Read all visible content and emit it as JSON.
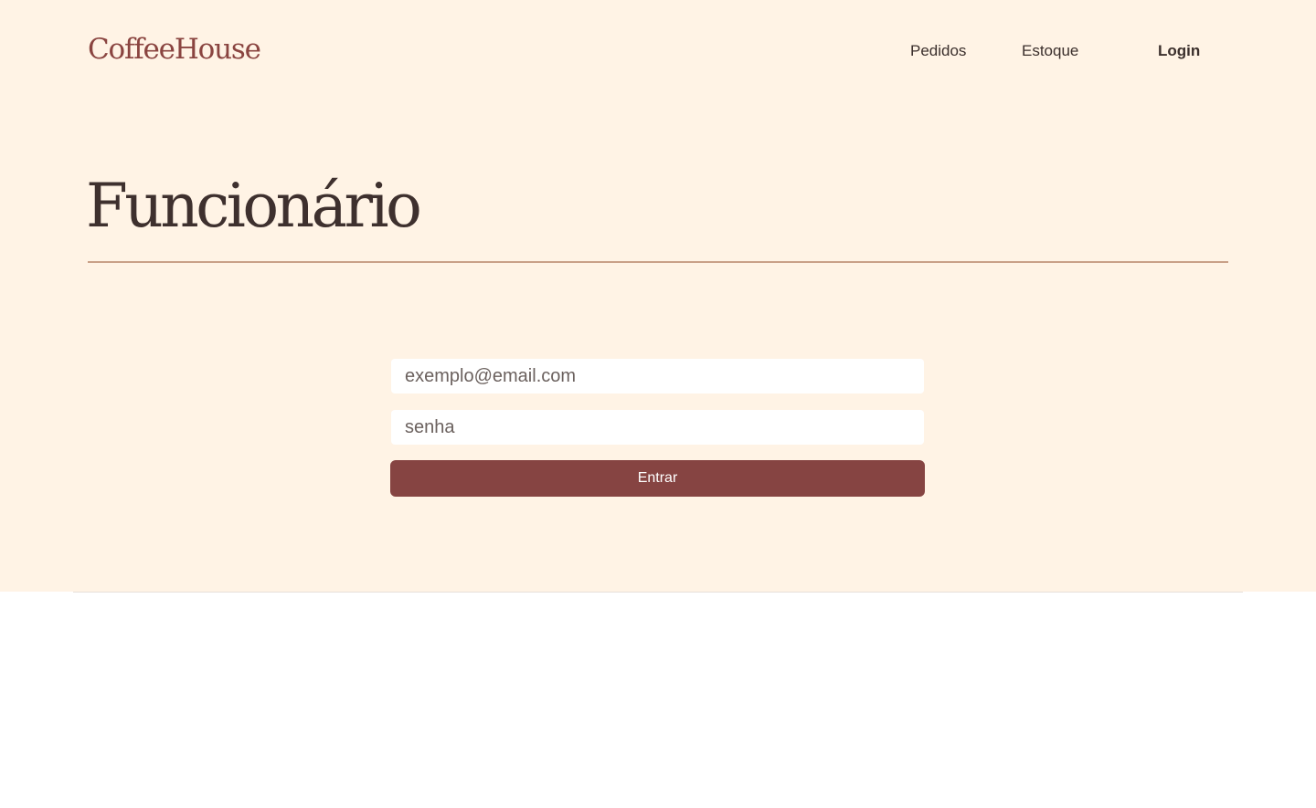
{
  "header": {
    "brand": "CoffeeHouse",
    "nav": {
      "pedidos": "Pedidos",
      "estoque": "Estoque",
      "login": "Login"
    }
  },
  "main": {
    "title": "Funcionário",
    "form": {
      "email_placeholder": "exemplo@email.com",
      "password_placeholder": "senha",
      "submit_label": "Entrar"
    }
  },
  "colors": {
    "background": "#fff3e5",
    "brand": "#8a4440",
    "button": "#864442",
    "divider": "#c9a088",
    "text": "#3e302e"
  }
}
